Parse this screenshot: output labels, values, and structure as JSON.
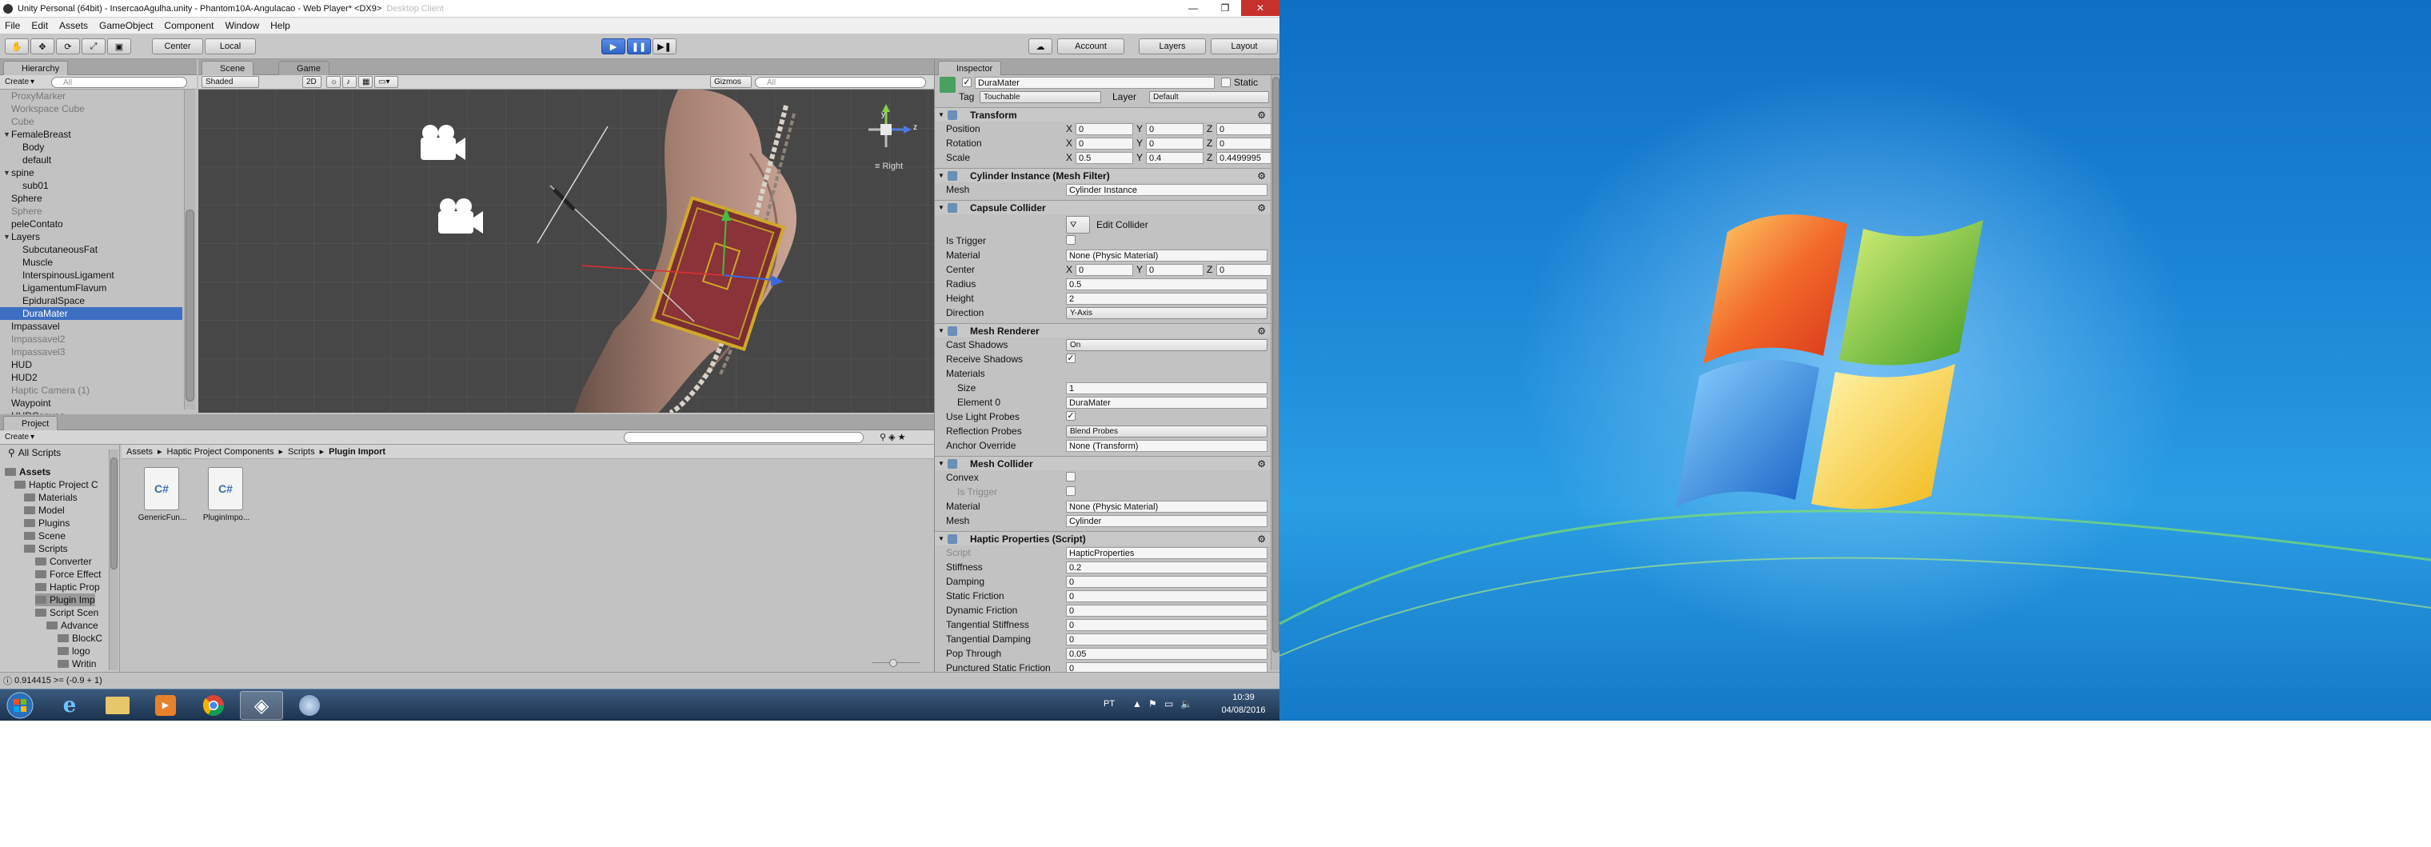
{
  "window": {
    "title": "Unity Personal (64bit) - InsercaoAgulha.unity - Phantom10A-Angulacao - Web Player* <DX9>",
    "title_suffix": "Desktop Client"
  },
  "menu": [
    "File",
    "Edit",
    "Assets",
    "GameObject",
    "Component",
    "Window",
    "Help"
  ],
  "toolbar": {
    "pivot": "Center",
    "space": "Local",
    "account": "Account",
    "layers": "Layers",
    "layout": "Layout"
  },
  "hierarchy": {
    "tab": "Hierarchy",
    "create": "Create",
    "search_placeholder": "All",
    "items": [
      {
        "label": "ProxyMarker",
        "dim": true
      },
      {
        "label": "Workspace Cube",
        "dim": true
      },
      {
        "label": "Cube",
        "dim": true
      },
      {
        "label": "FemaleBreast",
        "dim": false
      },
      {
        "label": "Body",
        "dim": false
      },
      {
        "label": "default",
        "dim": false
      },
      {
        "label": "spine",
        "dim": false
      },
      {
        "label": "sub01",
        "dim": false
      },
      {
        "label": "Sphere",
        "dim": false
      },
      {
        "label": "Sphere",
        "dim": true
      },
      {
        "label": "peleContato",
        "dim": false
      },
      {
        "label": "Layers",
        "dim": false
      },
      {
        "label": "SubcutaneousFat",
        "dim": false
      },
      {
        "label": "Muscle",
        "dim": false
      },
      {
        "label": "InterspinousLigament",
        "dim": false
      },
      {
        "label": "LigamentumFlavum",
        "dim": false
      },
      {
        "label": "EpiduralSpace",
        "dim": false
      },
      {
        "label": "DuraMater",
        "dim": false
      },
      {
        "label": "Impassavel",
        "dim": false
      },
      {
        "label": "Impassavel2",
        "dim": true
      },
      {
        "label": "Impassavel3",
        "dim": true
      },
      {
        "label": "HUD",
        "dim": false
      },
      {
        "label": "HUD2",
        "dim": false
      },
      {
        "label": "Haptic Camera (1)",
        "dim": true
      },
      {
        "label": "Waypoint",
        "dim": false
      },
      {
        "label": "HUDCanvas",
        "dim": false
      }
    ]
  },
  "scene": {
    "tab_scene": "Scene",
    "tab_game": "Game",
    "shading": "Shaded",
    "mode_2d": "2D",
    "gizmos": "Gizmos",
    "search_placeholder": "All",
    "view_label": "Right",
    "axis_y": "y",
    "axis_z": "z"
  },
  "project": {
    "tab": "Project",
    "create": "Create",
    "favorites": "All Scripts",
    "breadcrumb": [
      "Assets",
      "Haptic Project Components",
      "Scripts",
      "Plugin Import"
    ],
    "tree": [
      {
        "label": "Assets",
        "bold": true
      },
      {
        "label": "Haptic Project C"
      },
      {
        "label": "Materials"
      },
      {
        "label": "Model"
      },
      {
        "label": "Plugins"
      },
      {
        "label": "Scene"
      },
      {
        "label": "Scripts"
      },
      {
        "label": "Converter"
      },
      {
        "label": "Force Effect"
      },
      {
        "label": "Haptic Prop"
      },
      {
        "label": "Plugin Imp"
      },
      {
        "label": "Script Scen"
      },
      {
        "label": "Advance"
      },
      {
        "label": "BlockC"
      },
      {
        "label": "logo"
      },
      {
        "label": "Writin"
      }
    ],
    "files": [
      {
        "name": "GenericFun...",
        "glyph": "C#"
      },
      {
        "name": "PluginImpo...",
        "glyph": "C#"
      }
    ]
  },
  "inspector": {
    "tab": "Inspector",
    "object_name": "DuraMater",
    "static_label": "Static",
    "tag_label": "Tag",
    "tag_value": "Touchable",
    "layer_label": "Layer",
    "layer_value": "Default",
    "transform": {
      "title": "Transform",
      "rows": [
        {
          "label": "Position",
          "x": "0",
          "y": "0",
          "z": "0"
        },
        {
          "label": "Rotation",
          "x": "0",
          "y": "0",
          "z": "0"
        },
        {
          "label": "Scale",
          "x": "0.5",
          "y": "0.4",
          "z": "0.4499995"
        }
      ]
    },
    "mesh_filter": {
      "title": "Cylinder Instance (Mesh Filter)",
      "mesh_label": "Mesh",
      "mesh_value": "Cylinder Instance"
    },
    "capsule": {
      "title": "Capsule Collider",
      "edit_label": "Edit Collider",
      "is_trigger": "Is Trigger",
      "material_label": "Material",
      "material_value": "None (Physic Material)",
      "center_label": "Center",
      "center": {
        "x": "0",
        "y": "0",
        "z": "0"
      },
      "radius_label": "Radius",
      "radius_value": "0.5",
      "height_label": "Height",
      "height_value": "2",
      "direction_label": "Direction",
      "direction_value": "Y-Axis"
    },
    "renderer": {
      "title": "Mesh Renderer",
      "cast_label": "Cast Shadows",
      "cast_value": "On",
      "receive_label": "Receive Shadows",
      "materials_label": "Materials",
      "size_label": "Size",
      "size_value": "1",
      "element_label": "Element 0",
      "element_value": "DuraMater",
      "light_probes_label": "Use Light Probes",
      "reflection_label": "Reflection Probes",
      "reflection_value": "Blend Probes",
      "anchor_label": "Anchor Override",
      "anchor_value": "None (Transform)"
    },
    "mesh_collider": {
      "title": "Mesh Collider",
      "convex": "Convex",
      "is_trigger": "Is Trigger",
      "material_label": "Material",
      "material_value": "None (Physic Material)",
      "mesh_label": "Mesh",
      "mesh_value": "Cylinder"
    },
    "haptic": {
      "title": "Haptic Properties (Script)",
      "script_label": "Script",
      "script_value": "HapticProperties",
      "rows": [
        {
          "label": "Stiffness",
          "value": "0.2"
        },
        {
          "label": "Damping",
          "value": "0"
        },
        {
          "label": "Static Friction",
          "value": "0"
        },
        {
          "label": "Dynamic Friction",
          "value": "0"
        },
        {
          "label": "Tangential Stiffness",
          "value": "0"
        },
        {
          "label": "Tangential Damping",
          "value": "0"
        },
        {
          "label": "Pop Through",
          "value": "0.05"
        },
        {
          "label": "Punctured Static Friction",
          "value": "0"
        }
      ]
    }
  },
  "status": {
    "text": "0.914415 >= (-0.9 + 1)"
  },
  "taskbar": {
    "lang": "PT",
    "time": "10:39",
    "date": "04/08/2016"
  }
}
